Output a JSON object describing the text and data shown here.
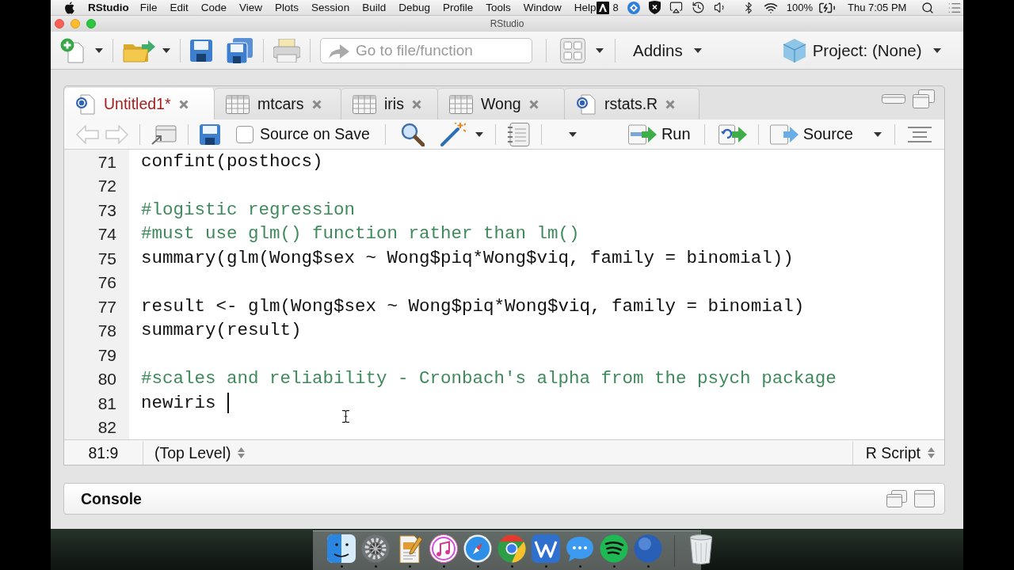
{
  "menu_bar": {
    "app_name": "RStudio",
    "menus": [
      "File",
      "Edit",
      "Code",
      "View",
      "Plots",
      "Session",
      "Build",
      "Debug",
      "Profile",
      "Tools",
      "Window",
      "Help"
    ],
    "badge_count": "8",
    "battery": "100%",
    "clock": "Thu 7:05 PM"
  },
  "window": {
    "title": "RStudio"
  },
  "main_toolbar": {
    "goto_placeholder": "Go to file/function",
    "addins": "Addins",
    "project": "Project: (None)"
  },
  "source_pane": {
    "tabs": [
      {
        "label": "Untitled1*",
        "kind": "script",
        "selected": true,
        "modified": true
      },
      {
        "label": "mtcars",
        "kind": "data",
        "selected": false,
        "modified": false
      },
      {
        "label": "iris",
        "kind": "data",
        "selected": false,
        "modified": false
      },
      {
        "label": "Wong",
        "kind": "data",
        "selected": false,
        "modified": false
      },
      {
        "label": "rstats.R",
        "kind": "script",
        "selected": false,
        "modified": false
      }
    ],
    "toolbar": {
      "back": {
        "disabled": true
      },
      "forward": {
        "disabled": true
      },
      "source_on_save": {
        "label": "Source on Save",
        "checked": false
      },
      "run": "Run",
      "source": "Source"
    },
    "lines": [
      {
        "number": "71",
        "kind": "code",
        "text": "confint(posthocs)",
        "cursor": false
      },
      {
        "number": "72",
        "kind": "blank",
        "cursor": false
      },
      {
        "number": "73",
        "kind": "comment",
        "text": "#logistic regression",
        "cursor": false
      },
      {
        "number": "74",
        "kind": "comment",
        "text": "#must use glm() function rather than lm()",
        "cursor": false
      },
      {
        "number": "75",
        "kind": "code",
        "text": "summary(glm(Wong$sex ~ Wong$piq*Wong$viq, family = binomial))",
        "cursor": false
      },
      {
        "number": "76",
        "kind": "blank",
        "cursor": false
      },
      {
        "number": "77",
        "kind": "code",
        "text": "result <- glm(Wong$sex ~ Wong$piq*Wong$viq, family = binomial)",
        "cursor": false
      },
      {
        "number": "78",
        "kind": "code",
        "text": "summary(result)",
        "cursor": false
      },
      {
        "number": "79",
        "kind": "blank",
        "cursor": false
      },
      {
        "number": "80",
        "kind": "comment",
        "text": "#scales and reliability - Cronbach's alpha from the psych package",
        "cursor": false
      },
      {
        "number": "81",
        "kind": "code",
        "text": "newiris",
        "cursor": true
      },
      {
        "number": "82",
        "kind": "blank",
        "cursor": false
      }
    ],
    "status_bar": {
      "position": "81:9",
      "scope": "(Top Level)",
      "file_type": "R Script"
    }
  },
  "console_pane": {
    "title": "Console"
  },
  "dock": {
    "apps": [
      {
        "kind": "finder",
        "running": true
      },
      {
        "kind": "settings",
        "running": true
      },
      {
        "kind": "pages",
        "running": true
      },
      {
        "kind": "music",
        "running": true
      },
      {
        "kind": "safari",
        "running": true
      },
      {
        "kind": "chrome",
        "running": true
      },
      {
        "kind": "word",
        "running": true
      },
      {
        "kind": "messages",
        "running": true
      },
      {
        "kind": "spotify",
        "running": true
      },
      {
        "kind": "r",
        "running": true
      },
      {
        "kind": "trash",
        "running": false
      }
    ]
  }
}
